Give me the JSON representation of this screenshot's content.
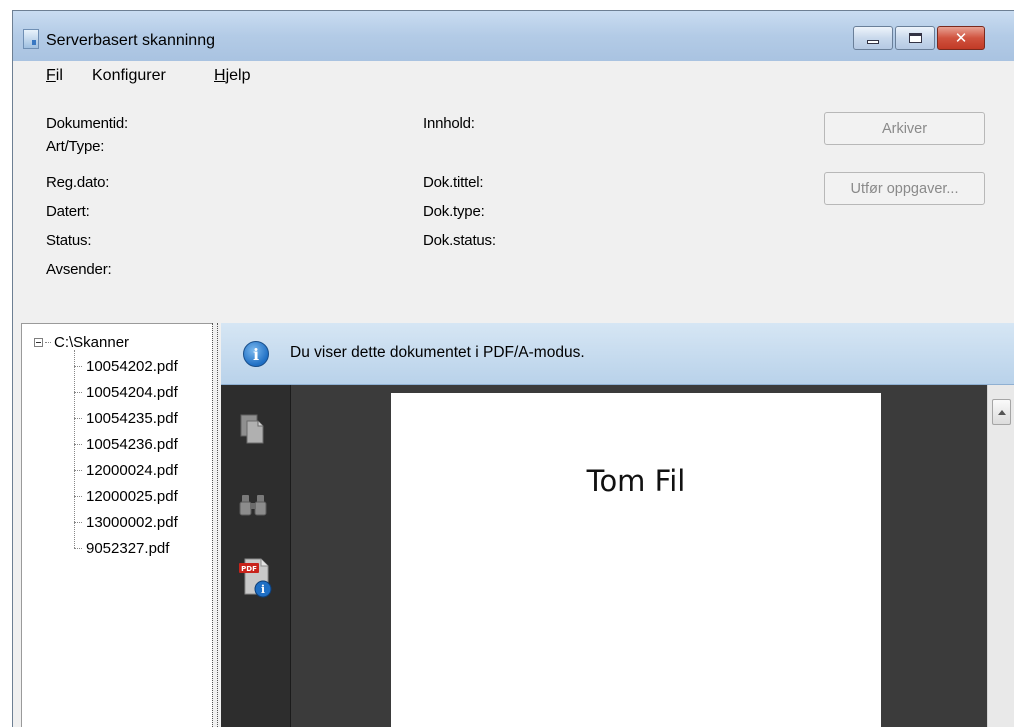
{
  "window": {
    "title": "Serverbasert skanninng"
  },
  "menu": [
    {
      "label": "Fil",
      "accel": "F",
      "rest": "il"
    },
    {
      "label": "Konfigurer"
    },
    {
      "label": "Hjelp",
      "accel": "H",
      "rest": "jelp"
    }
  ],
  "fields": {
    "dokumentid": "Dokumentid:",
    "art_type": "Art/Type:",
    "reg_dato": "Reg.dato:",
    "datert": "Datert:",
    "status": "Status:",
    "avsender": "Avsender:",
    "innhold": "Innhold:",
    "dok_tittel": "Dok.tittel:",
    "dok_type": "Dok.type:",
    "dok_status": "Dok.status:"
  },
  "buttons": {
    "arkiver": "Arkiver",
    "utfor": "Utfør oppgaver..."
  },
  "tree": {
    "root": "C:\\Skanner",
    "items": [
      "10054202.pdf",
      "10054204.pdf",
      "10054235.pdf",
      "10054236.pdf",
      "12000024.pdf",
      "12000025.pdf",
      "13000002.pdf",
      "9052327.pdf"
    ]
  },
  "viewer": {
    "info_text": "Du viser dette dokumentet i PDF/A-modus.",
    "page_text": "Tom Fil",
    "pdf_badge": "PDF"
  },
  "icons": [
    "app-icon",
    "minimize-icon",
    "maximize-icon",
    "close-icon",
    "info-icon",
    "pages-icon",
    "binoculars-icon",
    "pdf-info-icon",
    "scroll-up-arrow-icon"
  ]
}
